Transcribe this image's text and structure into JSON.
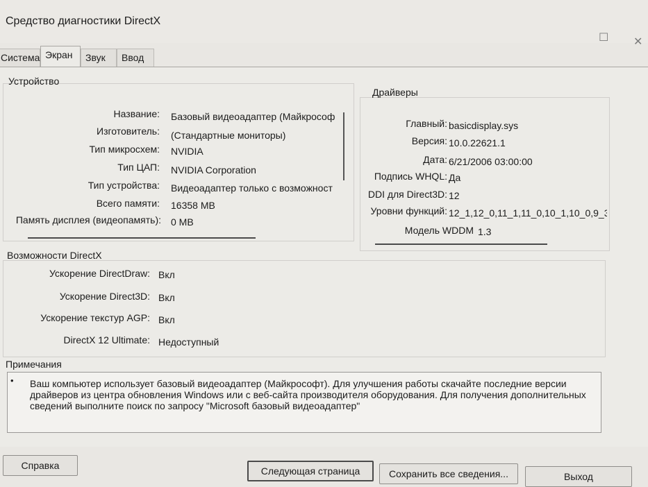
{
  "window": {
    "title": "Средство диагностики DirectX",
    "maximize_icon": "☐",
    "close_icon": "✕"
  },
  "tabs": [
    {
      "label": "Система"
    },
    {
      "label": "Экран"
    },
    {
      "label": "Звук"
    },
    {
      "label": "Ввод"
    }
  ],
  "device": {
    "title": "Устройство",
    "fields": [
      {
        "label": "Название:",
        "value": "Базовый видеоадаптер (Майкрософ"
      },
      {
        "label": "Изготовитель:",
        "value": "(Стандартные мониторы)"
      },
      {
        "label": "Тип микросхем:",
        "value": "NVIDIA"
      },
      {
        "label": "Тип ЦАП:",
        "value": "NVIDIA Corporation"
      },
      {
        "label": "Тип устройства:",
        "value": "Видеоадаптер только с возможност"
      },
      {
        "label": "Всего памяти:",
        "value": "16358 MB"
      },
      {
        "label": "Память дисплея (видеопамять):",
        "value": "0 MB"
      }
    ]
  },
  "drivers": {
    "title": "Драйверы",
    "fields": [
      {
        "label": "Главный:",
        "value": "basicdisplay.sys"
      },
      {
        "label": "Версия:",
        "value": "10.0.22621.1"
      },
      {
        "label": "Дата:",
        "value": "6/21/2006 03:00:00"
      },
      {
        "label": "Подпись WHQL:",
        "value": "Да"
      },
      {
        "label": "DDI для Direct3D:",
        "value": "12"
      },
      {
        "label": "Уровни функций:",
        "value": "12_1,12_0,11_1,11_0,10_1,10_0,9_3"
      },
      {
        "label": "Модель WDDM",
        "value": "1.3"
      }
    ]
  },
  "directx": {
    "title": "Возможности DirectX",
    "fields": [
      {
        "label": "Ускорение DirectDraw:",
        "value": "Вкл"
      },
      {
        "label": "Ускорение Direct3D:",
        "value": "Вкл"
      },
      {
        "label": "Ускорение текстур AGP:",
        "value": "Вкл"
      },
      {
        "label": "DirectX 12 Ultimate:",
        "value": "Недоступный"
      }
    ]
  },
  "notes": {
    "title": "Примечания",
    "bullet": "•",
    "text": "Ваш компьютер использует базовый видеоадаптер (Майкрософт). Для улучшения работы скачайте последние версии драйверов из центра обновления Windows или с веб-сайта производителя оборудования. Для получения дополнительных сведений выполните поиск по запросу \"Microsoft базовый видеоадаптер\""
  },
  "buttons": {
    "help": "Справка",
    "next_page": "Следующая страница",
    "save_all": "Сохранить все сведения...",
    "exit": "Выход"
  }
}
